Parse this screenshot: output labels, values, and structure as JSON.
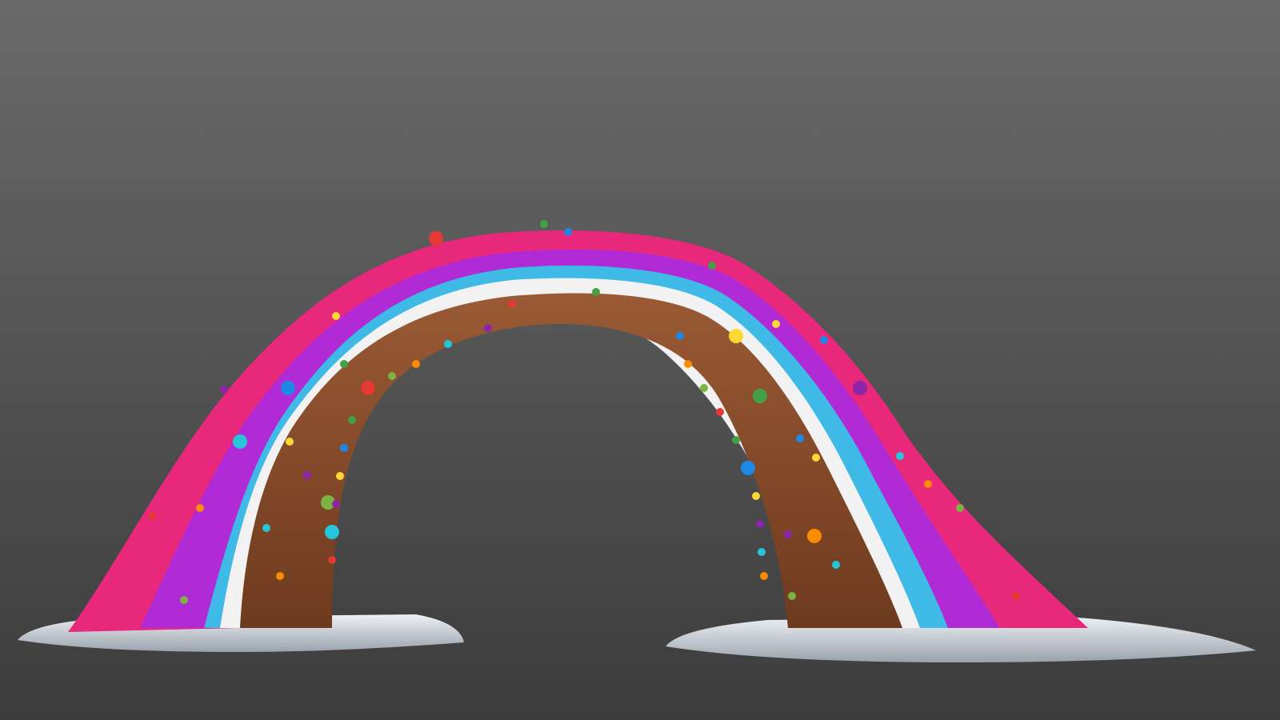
{
  "scene": {
    "subject": "gingerbread-arch-with-icing",
    "colors": {
      "background_top": "#6a6a6a",
      "background_bottom": "#3c3c3c",
      "gingerbread_light": "#9a5a35",
      "gingerbread_dark": "#6e3a1e",
      "icing_white": "#f2f2f2",
      "icing_cyan": "#3fb9e6",
      "icing_purple": "#b02ad6",
      "icing_pink": "#e8287a",
      "snow": "#dfe4ea",
      "snow_shadow": "#9aa3ad"
    },
    "sprinkle_colors": [
      "#e53935",
      "#43a047",
      "#1e88e5",
      "#fdd835",
      "#8e24aa",
      "#26c6da",
      "#fb8c00",
      "#7cb342"
    ]
  }
}
